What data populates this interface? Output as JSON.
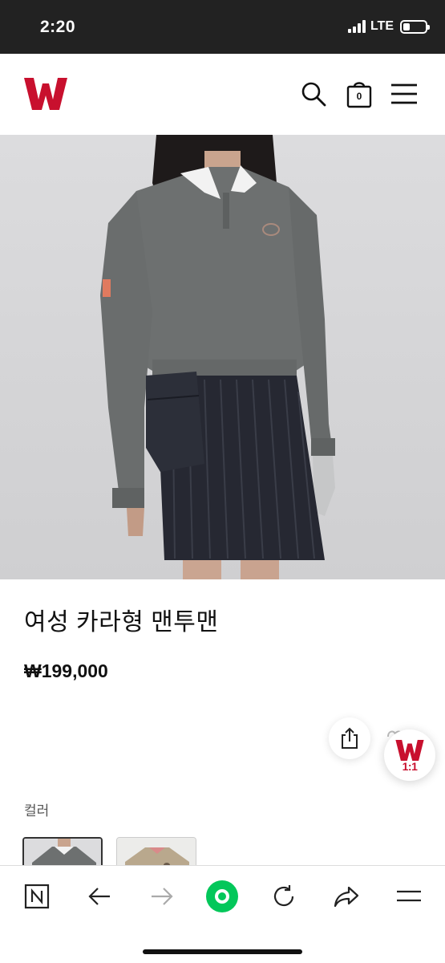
{
  "status_bar": {
    "time": "2:20",
    "network": "LTE",
    "battery_fraction": 0.3
  },
  "header": {
    "logo_icon": "wilson-w-logo",
    "cart_count": "0",
    "brand_color": "#c8102e"
  },
  "product": {
    "title": "여성 카라형 맨투맨",
    "price": "₩199,000",
    "color_label": "컬러",
    "swatches": [
      "charcoal-grey",
      "beige"
    ]
  },
  "chat_fab": {
    "label": "1:1"
  },
  "browser_toolbar": {
    "items": [
      "n-home-icon",
      "back-arrow-icon",
      "forward-arrow-icon",
      "green-circle-icon",
      "reload-icon",
      "share-forward-icon",
      "menu-lines-icon"
    ]
  }
}
